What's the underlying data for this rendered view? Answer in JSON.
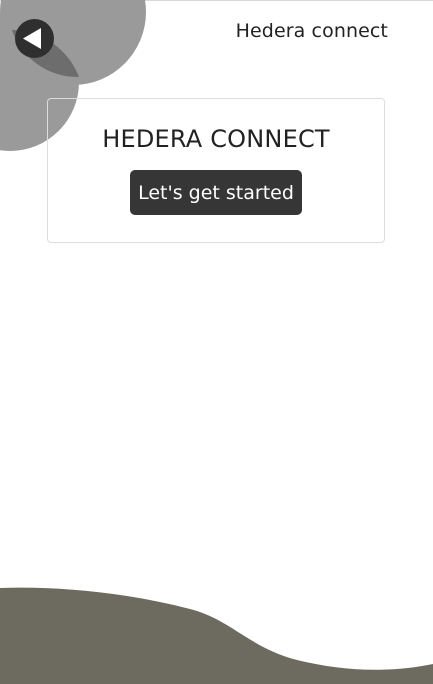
{
  "header": {
    "title": "Hedera connect"
  },
  "card": {
    "title": "HEDERA CONNECT",
    "button_label": "Let's get started"
  },
  "icons": {
    "back": "back-arrow-icon"
  },
  "colors": {
    "decor_circle": "#9a9a9a",
    "back_button": "#2f2f2f",
    "start_button": "#363636",
    "bottom_wave": "#6d6a5f",
    "text": "#222222"
  }
}
